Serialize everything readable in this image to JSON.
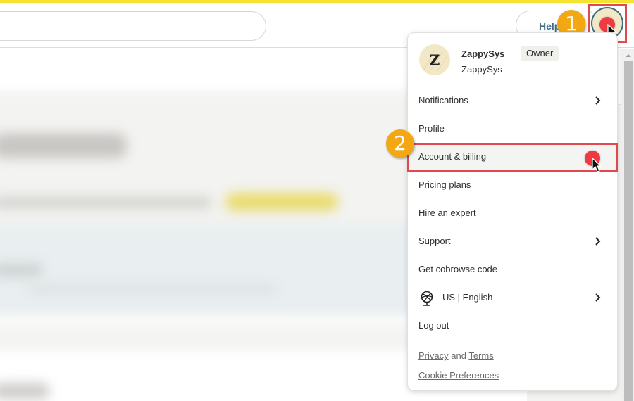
{
  "header": {
    "search": {
      "placeholder": ""
    },
    "help_label": "Help"
  },
  "user_menu": {
    "avatar_initial": "Z",
    "profile": {
      "name": "ZappySys",
      "role": "Owner",
      "org": "ZappySys"
    },
    "items": [
      {
        "label": "Notifications",
        "has_submenu": true
      },
      {
        "label": "Profile",
        "has_submenu": false
      },
      {
        "label": "Account & billing",
        "has_submenu": false,
        "highlighted": true
      },
      {
        "label": "Pricing plans",
        "has_submenu": false
      },
      {
        "label": "Hire an expert",
        "has_submenu": false
      },
      {
        "label": "Support",
        "has_submenu": true
      },
      {
        "label": "Get cobrowse code",
        "has_submenu": false
      },
      {
        "label": "US | English",
        "has_submenu": true,
        "icon": "globe-icon"
      },
      {
        "label": "Log out",
        "has_submenu": false
      }
    ],
    "footer": {
      "privacy": "Privacy",
      "and": "and",
      "terms": "Terms",
      "cookie": "Cookie Preferences"
    }
  },
  "annotations": {
    "step1": "1",
    "step2": "2",
    "highlight_color": "#e04a4f",
    "badge_color": "#f3a712",
    "click_dot_color": "#ee3a40"
  },
  "colors": {
    "top_stripe": "#f5e32f",
    "help_text": "#406c8a"
  }
}
